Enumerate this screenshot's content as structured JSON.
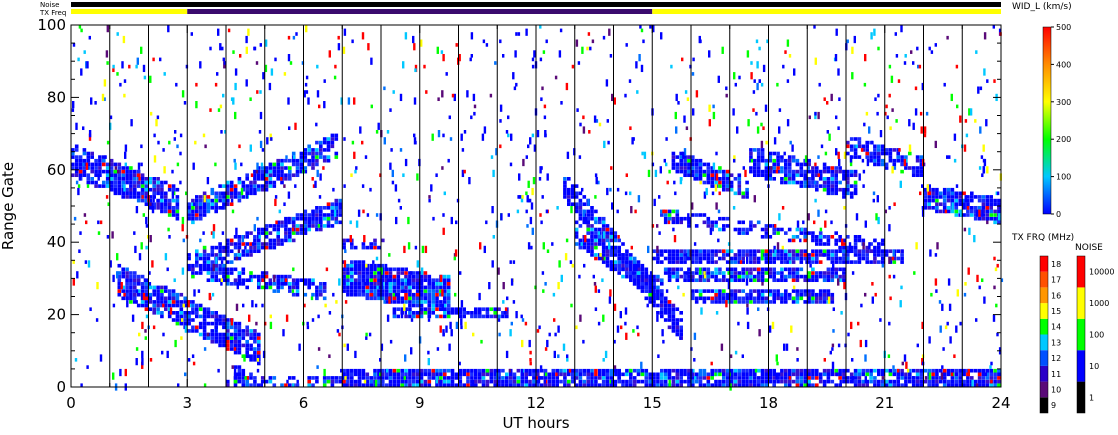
{
  "chart_data": {
    "type": "heatmap",
    "xlabel": "UT hours",
    "ylabel": "Range Gate",
    "xlim": [
      0,
      24
    ],
    "ylim": [
      0,
      100
    ],
    "x_ticks": [
      "0",
      "3",
      "6",
      "9",
      "12",
      "15",
      "18",
      "21",
      "24"
    ],
    "y_ticks": [
      "0",
      "20",
      "40",
      "60",
      "80",
      "100"
    ],
    "hour_markers": [
      1,
      2,
      3,
      4,
      5,
      6,
      7,
      8,
      9,
      10,
      11,
      12,
      13,
      14,
      15,
      16,
      17,
      18,
      19,
      20,
      21,
      22,
      23
    ],
    "status_bars": {
      "noise_label": "Noise",
      "txfreq_label": "TX Freq",
      "tx_segments": [
        {
          "start": 0,
          "end": 3,
          "color": "#ffff00"
        },
        {
          "start": 3,
          "end": 15,
          "color": "#3a0a6e"
        },
        {
          "start": 15,
          "end": 24,
          "color": "#ffff00"
        }
      ]
    },
    "echo_bands": [
      {
        "t0": 0.0,
        "t1": 2.8,
        "g0": 62,
        "g1": 50,
        "w": 7,
        "d": 0.85
      },
      {
        "t0": 1.2,
        "t1": 4.8,
        "g0": 29,
        "g1": 10,
        "w": 7,
        "d": 0.85
      },
      {
        "t0": 3.0,
        "t1": 6.8,
        "g0": 48,
        "g1": 66,
        "w": 5,
        "d": 0.8
      },
      {
        "t0": 3.0,
        "t1": 6.9,
        "g0": 33,
        "g1": 48,
        "w": 5,
        "d": 0.8
      },
      {
        "t0": 3.5,
        "t1": 6.5,
        "g0": 31,
        "g1": 26,
        "w": 3,
        "d": 0.7
      },
      {
        "t0": 4.2,
        "t1": 4.6,
        "g0": 3,
        "g1": 0,
        "w": 4,
        "d": 0.8
      },
      {
        "t0": 7.0,
        "t1": 9.7,
        "g0": 30,
        "g1": 25,
        "w": 8,
        "d": 0.95
      },
      {
        "t0": 8.3,
        "t1": 11.2,
        "g0": 20,
        "g1": 20,
        "w": 2,
        "d": 0.8
      },
      {
        "t0": 7.0,
        "t1": 8.0,
        "g0": 39,
        "g1": 39,
        "w": 1,
        "d": 0.6
      },
      {
        "t0": 12.7,
        "t1": 15.7,
        "g0": 55,
        "g1": 16,
        "w": 6,
        "d": 0.8
      },
      {
        "t0": 13.0,
        "t1": 15.2,
        "g0": 42,
        "g1": 26,
        "w": 5,
        "d": 0.8
      },
      {
        "t0": 15.0,
        "t1": 21.5,
        "g0": 36,
        "g1": 35,
        "w": 2,
        "d": 0.85
      },
      {
        "t0": 15.3,
        "t1": 20.0,
        "g0": 31,
        "g1": 30,
        "w": 2,
        "d": 0.85
      },
      {
        "t0": 16.0,
        "t1": 19.7,
        "g0": 25,
        "g1": 24,
        "w": 2,
        "d": 0.85
      },
      {
        "t0": 15.5,
        "t1": 17.5,
        "g0": 62,
        "g1": 54,
        "w": 4,
        "d": 0.8
      },
      {
        "t0": 17.5,
        "t1": 20.3,
        "g0": 62,
        "g1": 55,
        "w": 6,
        "d": 0.8
      },
      {
        "t0": 20.0,
        "t1": 22.0,
        "g0": 66,
        "g1": 60,
        "w": 4,
        "d": 0.7
      },
      {
        "t0": 22.0,
        "t1": 24.0,
        "g0": 52,
        "g1": 48,
        "w": 5,
        "d": 0.85
      },
      {
        "t0": 15.2,
        "t1": 21.0,
        "g0": 47,
        "g1": 38,
        "w": 2,
        "d": 0.6
      },
      {
        "t0": 7.0,
        "t1": 24.0,
        "g0": 2,
        "g1": 2,
        "w": 3,
        "d": 0.9
      },
      {
        "t0": 4.0,
        "t1": 7.0,
        "g0": 1,
        "g1": 1,
        "w": 1,
        "d": 0.5
      }
    ],
    "colorbars": [
      {
        "title": "WID_L (km/s)",
        "type": "continuous",
        "min": 0,
        "max": 500,
        "tick_labels": [
          "0",
          "100",
          "200",
          "300",
          "400",
          "500"
        ],
        "stops": [
          "#0000ff",
          "#00c8ff",
          "#00ff00",
          "#ffff00",
          "#ff8c00",
          "#ff0000"
        ]
      },
      {
        "title": "TX FRQ (MHz)",
        "type": "discrete",
        "tick_labels": [
          "9",
          "10",
          "11",
          "12",
          "13",
          "14",
          "15",
          "16",
          "17",
          "18"
        ],
        "colors": [
          "#000000",
          "#5a0a78",
          "#2a00c8",
          "#0050ff",
          "#00c8ff",
          "#00ff00",
          "#ffff00",
          "#ff9600",
          "#ff5000",
          "#ff0000"
        ]
      },
      {
        "title": "NOISE",
        "type": "discrete",
        "tick_labels": [
          "1",
          "10",
          "100",
          "1000",
          "10000"
        ],
        "colors": [
          "#000000",
          "#0000ff",
          "#00ff00",
          "#ffff00",
          "#ff0000"
        ]
      }
    ]
  }
}
